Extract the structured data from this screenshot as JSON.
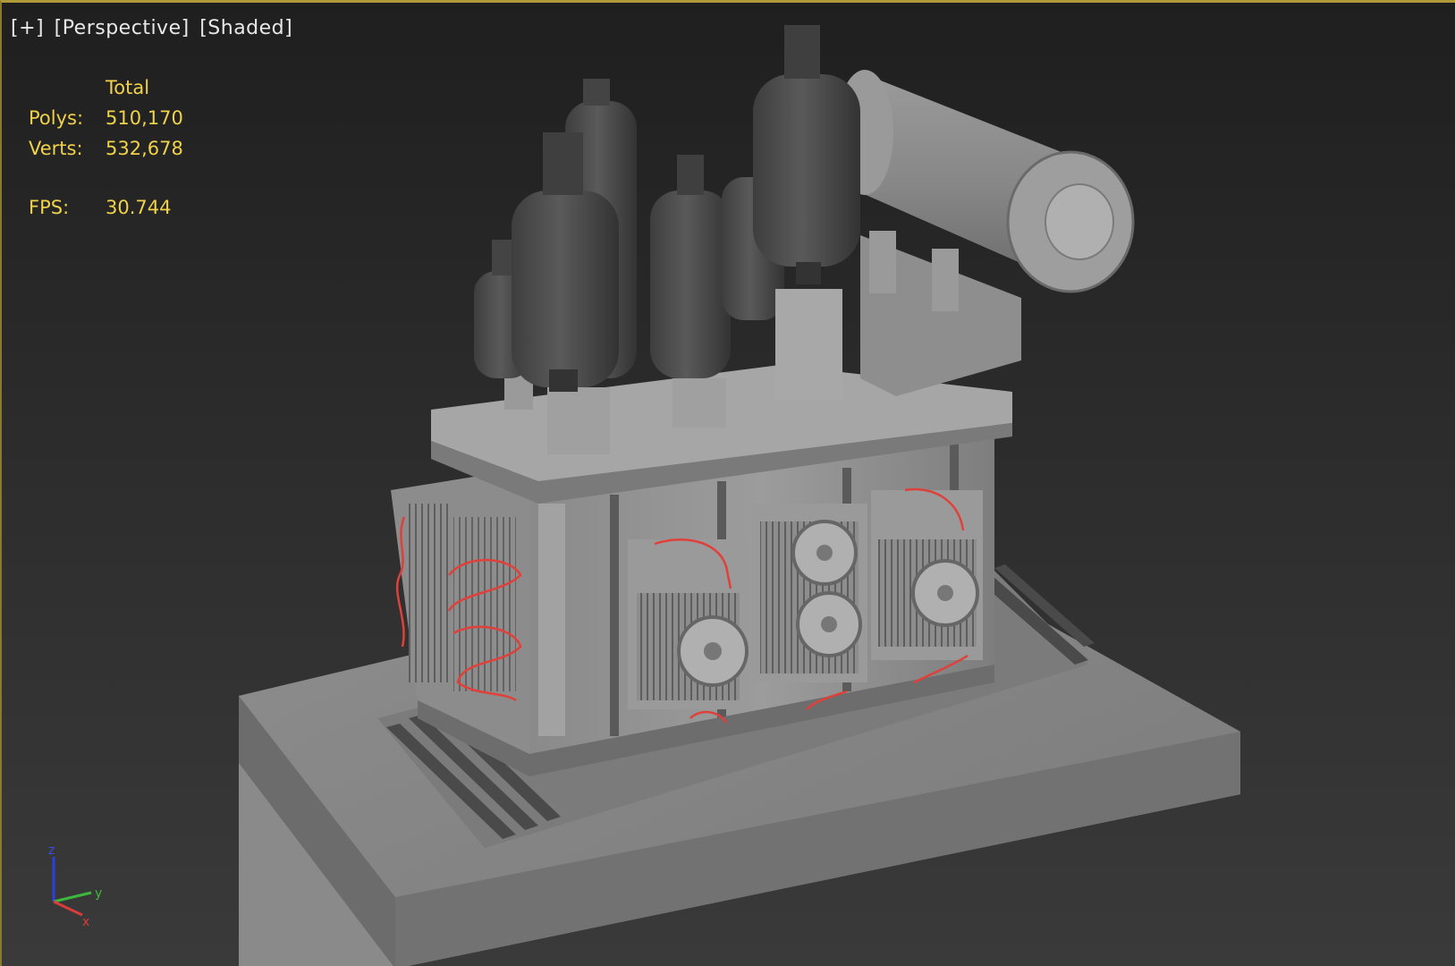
{
  "viewport": {
    "labels": {
      "plus": "[+]",
      "view": "[Perspective]",
      "mode": "[Shaded]"
    },
    "stats": {
      "header": "Total",
      "polys_label": "Polys:",
      "polys_value": "510,170",
      "verts_label": "Verts:",
      "verts_value": "532,678",
      "fps_label": "FPS:",
      "fps_value": "30.744"
    },
    "axis_gizmo": {
      "z": "z",
      "y": "y",
      "x": "x"
    },
    "colors": {
      "stats_text": "#f0d24a",
      "label_text": "#e8e8e8",
      "active_border": "#b09a3a",
      "wire": "#e0403a"
    }
  }
}
